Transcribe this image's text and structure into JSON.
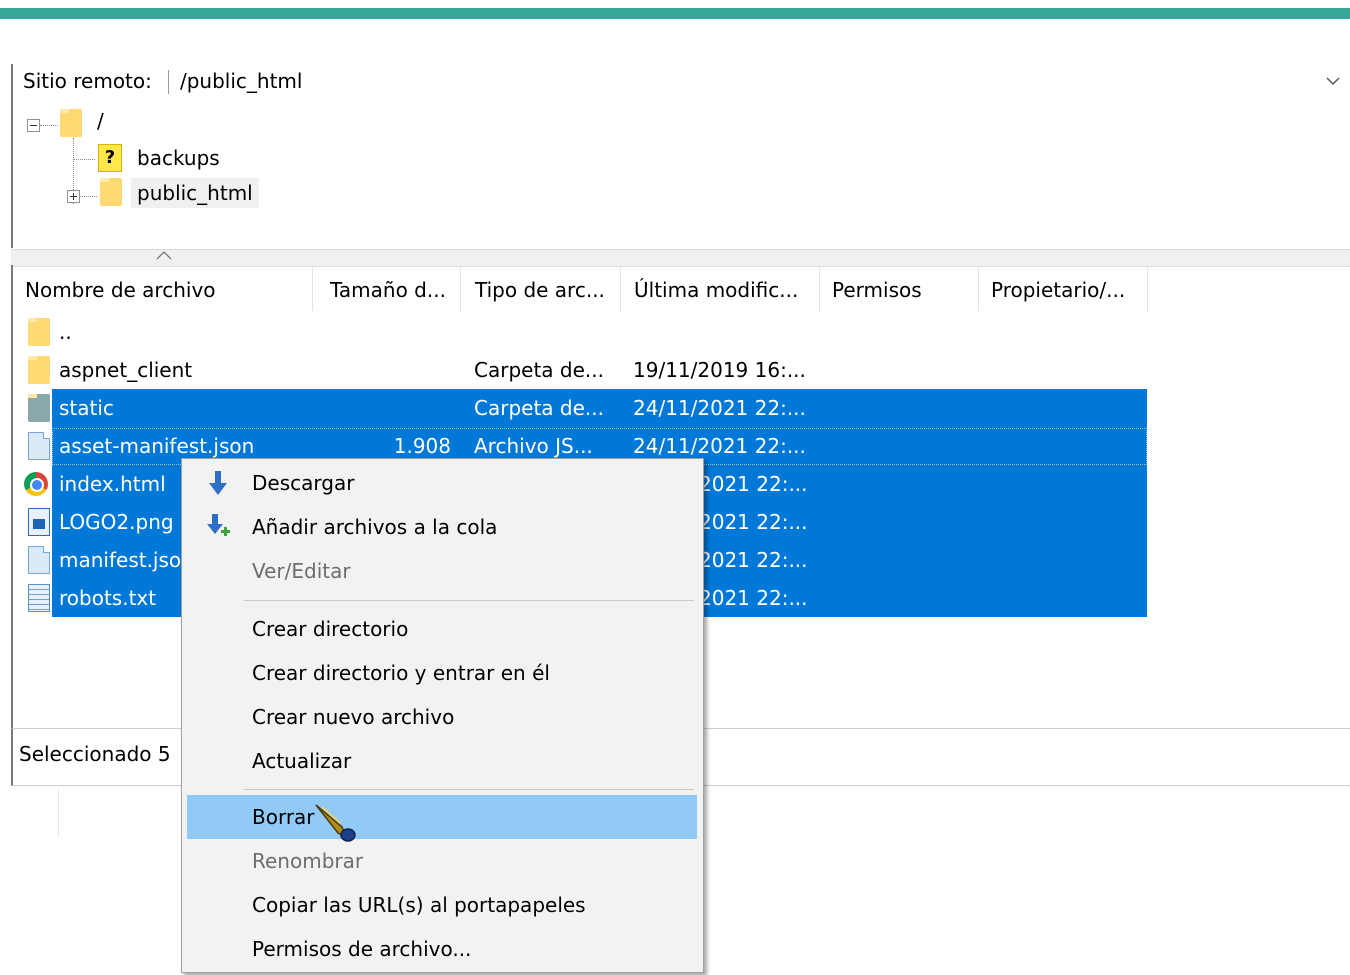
{
  "colors": {
    "accent_bar": "#35a89a",
    "selection": "#0078d7",
    "menu_hover": "#91c9f7"
  },
  "remote": {
    "label": "Sitio remoto:",
    "path": "/public_html",
    "dropdown_icon": "chevron-down-icon"
  },
  "tree": {
    "root": "/",
    "items": [
      {
        "label": "backups",
        "icon": "unknown-folder-icon"
      },
      {
        "label": "public_html",
        "icon": "folder-icon"
      }
    ]
  },
  "columns": [
    "Nombre de archivo",
    "Tamaño d...",
    "Tipo de arc...",
    "Última modific...",
    "Permisos",
    "Propietario/..."
  ],
  "files": [
    {
      "name": "..",
      "size": "",
      "type": "",
      "modified": "",
      "icon": "folder-icon",
      "selected": false
    },
    {
      "name": "aspnet_client",
      "size": "",
      "type": "Carpeta de...",
      "modified": "19/11/2019 16:...",
      "icon": "folder-icon",
      "selected": false
    },
    {
      "name": "static",
      "size": "",
      "type": "Carpeta de...",
      "modified": "24/11/2021 22:...",
      "icon": "folder-icon",
      "selected": true
    },
    {
      "name": "asset-manifest.json",
      "size": "1.908",
      "type": "Archivo JS...",
      "modified": "24/11/2021 22:...",
      "icon": "file-icon",
      "selected": true
    },
    {
      "name": "index.html",
      "size": "",
      "type": "",
      "modified": "2021 22:...",
      "icon": "chrome-icon",
      "selected": true
    },
    {
      "name": "LOGO2.png",
      "size": "",
      "type": "",
      "modified": "2021 22:...",
      "icon": "image-file-icon",
      "selected": true
    },
    {
      "name": "manifest.jso",
      "size": "",
      "type": "",
      "modified": "2021 22:...",
      "icon": "file-icon",
      "selected": true
    },
    {
      "name": "robots.txt",
      "size": "",
      "type": "",
      "modified": "2021 22:...",
      "icon": "text-file-icon",
      "selected": true
    }
  ],
  "status": {
    "text": "Seleccionado 5"
  },
  "context_menu": {
    "items": [
      {
        "label": "Descargar",
        "icon": "download-arrow-icon",
        "disabled": false
      },
      {
        "label": "Añadir archivos a la cola",
        "icon": "add-to-queue-icon",
        "disabled": false
      },
      {
        "label": "Ver/Editar",
        "disabled": true
      },
      {
        "label": "Crear directorio",
        "disabled": false
      },
      {
        "label": "Crear directorio y entrar en él",
        "disabled": false
      },
      {
        "label": "Crear nuevo archivo",
        "disabled": false
      },
      {
        "label": "Actualizar",
        "disabled": false
      },
      {
        "label": "Borrar",
        "disabled": false,
        "hover": true
      },
      {
        "label": "Renombrar",
        "disabled": true
      },
      {
        "label": "Copiar las URL(s) al portapapeles",
        "disabled": false
      },
      {
        "label": "Permisos de archivo...",
        "disabled": false
      }
    ]
  }
}
